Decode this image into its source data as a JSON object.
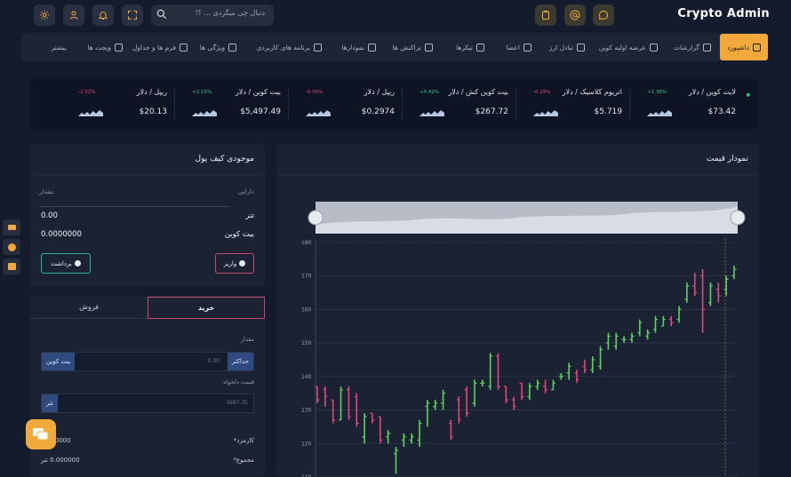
{
  "app": {
    "title": "Crypto Admin"
  },
  "search": {
    "placeholder": "دنبال چی میگردی ... ؟!"
  },
  "nav": {
    "items": [
      {
        "label": "داشبورد",
        "icon": "monitor-icon"
      },
      {
        "label": "گزارشات",
        "icon": "chart-icon"
      },
      {
        "label": "عرضه اولیه کوین",
        "icon": "clock-icon"
      },
      {
        "label": "تبادل ارز",
        "icon": "exchange-icon"
      },
      {
        "label": "اعضا",
        "icon": "users-icon"
      },
      {
        "label": "تیکرها",
        "icon": "sliders-icon"
      },
      {
        "label": "تراکنش ها",
        "icon": "dollar-icon"
      },
      {
        "label": "نمودارها",
        "icon": "pie-icon"
      },
      {
        "label": "برنامه های کاربردی",
        "icon": "grid-icon"
      },
      {
        "label": "ویژگی ها",
        "icon": "apps-icon"
      },
      {
        "label": "فرم ها و جداول",
        "icon": "form-icon"
      },
      {
        "label": "ویجت ها",
        "icon": "edit-icon"
      },
      {
        "label": "بیشتر",
        "icon": ""
      }
    ]
  },
  "tickers": [
    {
      "name": "لایت کوین / دلار",
      "change": "+1.36%",
      "price": "$73.42",
      "up": true
    },
    {
      "name": "اتریوم کلاسیک / دلار",
      "change": "-0.19%",
      "price": "$5.719",
      "up": false
    },
    {
      "name": "بیت کوین کش / دلار",
      "change": "+0.42%",
      "price": "$267.72",
      "up": true
    },
    {
      "name": "ریپل / دلار",
      "change": "-0.50%",
      "price": "$0.2974",
      "up": false
    },
    {
      "name": "بیت کوین / دلار",
      "change": "+3.15%",
      "price": "$5,497.49",
      "up": true
    },
    {
      "name": "ریپل / دلار",
      "change": "-2.52%",
      "price": "$20.13",
      "up": false
    }
  ],
  "wallet": {
    "title": "موجودی کیف پول",
    "col_asset": "دارایی",
    "col_amount": "مقدار",
    "rows": [
      {
        "asset": "تتر",
        "amount": "0.00"
      },
      {
        "asset": "بیت کوین",
        "amount": "0.0000000"
      }
    ],
    "deposit_label": "واریز",
    "withdraw_label": "برداشت"
  },
  "trade": {
    "tab_buy": "خرید",
    "tab_sell": "فروش",
    "amount_label": "مقدار",
    "max_label": "حداکثر",
    "amount_placeholder": "0.00",
    "amount_unit": "بیت کوین",
    "price_label": "قیمت دلخواه",
    "price_placeholder": "3987.35",
    "price_unit": "تتر",
    "fee_label": "کارمزد*",
    "fee_value": "0.000000",
    "total_label": "مجموع*",
    "total_value": "0.000000 تتر"
  },
  "price_chart": {
    "title": "نمودار قیمت"
  },
  "chart_data": {
    "type": "candlestick",
    "title": "نمودار قیمت",
    "yticks": [
      180,
      170,
      160,
      150,
      140,
      130,
      120,
      110
    ],
    "ylim": [
      110,
      181
    ],
    "colors": {
      "up": "#5fd35f",
      "down": "#e0487a"
    },
    "candles": [
      {
        "o": 137,
        "h": 137,
        "l": 132,
        "c": 133
      },
      {
        "o": 136,
        "h": 137,
        "l": 131,
        "c": 134
      },
      {
        "o": 133,
        "h": 133,
        "l": 126,
        "c": 127
      },
      {
        "o": 127,
        "h": 137,
        "l": 127,
        "c": 136
      },
      {
        "o": 136,
        "h": 137,
        "l": 127,
        "c": 128
      },
      {
        "o": 134,
        "h": 135,
        "l": 125,
        "c": 126
      },
      {
        "o": 122,
        "h": 129,
        "l": 120,
        "c": 128
      },
      {
        "o": 129,
        "h": 129,
        "l": 126,
        "c": 127
      },
      {
        "o": 128,
        "h": 128,
        "l": 120,
        "c": 121
      },
      {
        "o": 122,
        "h": 124,
        "l": 120,
        "c": 123
      },
      {
        "o": 117,
        "h": 119,
        "l": 111,
        "c": 118
      },
      {
        "o": 121,
        "h": 123,
        "l": 119,
        "c": 122
      },
      {
        "o": 121,
        "h": 123,
        "l": 120,
        "c": 122
      },
      {
        "o": 121,
        "h": 127,
        "l": 119,
        "c": 126
      },
      {
        "o": 131,
        "h": 133,
        "l": 125,
        "c": 132
      },
      {
        "o": 131,
        "h": 133,
        "l": 130,
        "c": 132
      },
      {
        "o": 132,
        "h": 136,
        "l": 130,
        "c": 135
      },
      {
        "o": 126,
        "h": 127,
        "l": 121,
        "c": 122
      },
      {
        "o": 133,
        "h": 134,
        "l": 126,
        "c": 127
      },
      {
        "o": 136,
        "h": 137,
        "l": 128,
        "c": 129
      },
      {
        "o": 132,
        "h": 139,
        "l": 131,
        "c": 138
      },
      {
        "o": 138,
        "h": 139,
        "l": 137,
        "c": 138
      },
      {
        "o": 137,
        "h": 147,
        "l": 136,
        "c": 146
      },
      {
        "o": 146,
        "h": 147,
        "l": 136,
        "c": 137
      },
      {
        "o": 137,
        "h": 137,
        "l": 132,
        "c": 133
      },
      {
        "o": 133,
        "h": 134,
        "l": 130,
        "c": 131
      },
      {
        "o": 138,
        "h": 138,
        "l": 133,
        "c": 134
      },
      {
        "o": 134,
        "h": 138,
        "l": 133,
        "c": 137
      },
      {
        "o": 137,
        "h": 139,
        "l": 136,
        "c": 138
      },
      {
        "o": 137,
        "h": 139,
        "l": 135,
        "c": 136
      },
      {
        "o": 136,
        "h": 139,
        "l": 136,
        "c": 138
      },
      {
        "o": 140,
        "h": 141,
        "l": 139,
        "c": 140
      },
      {
        "o": 141,
        "h": 144,
        "l": 139,
        "c": 143
      },
      {
        "o": 141,
        "h": 142,
        "l": 138,
        "c": 139
      },
      {
        "o": 143,
        "h": 145,
        "l": 141,
        "c": 142
      },
      {
        "o": 142,
        "h": 146,
        "l": 141,
        "c": 145
      },
      {
        "o": 143,
        "h": 149,
        "l": 142,
        "c": 148
      },
      {
        "o": 150,
        "h": 153,
        "l": 148,
        "c": 152
      },
      {
        "o": 149,
        "h": 153,
        "l": 148,
        "c": 152
      },
      {
        "o": 151,
        "h": 152,
        "l": 150,
        "c": 151
      },
      {
        "o": 151,
        "h": 153,
        "l": 150,
        "c": 152
      },
      {
        "o": 153,
        "h": 157,
        "l": 152,
        "c": 156
      },
      {
        "o": 152,
        "h": 154,
        "l": 151,
        "c": 153
      },
      {
        "o": 154,
        "h": 158,
        "l": 153,
        "c": 157
      },
      {
        "o": 155,
        "h": 158,
        "l": 155,
        "c": 157
      },
      {
        "o": 157,
        "h": 158,
        "l": 155,
        "c": 156
      },
      {
        "o": 157,
        "h": 161,
        "l": 156,
        "c": 160
      },
      {
        "o": 163,
        "h": 168,
        "l": 162,
        "c": 167
      },
      {
        "o": 167,
        "h": 171,
        "l": 164,
        "c": 165
      },
      {
        "o": 170,
        "h": 172,
        "l": 153,
        "c": 160
      },
      {
        "o": 162,
        "h": 168,
        "l": 161,
        "c": 167
      },
      {
        "o": 166,
        "h": 168,
        "l": 162,
        "c": 164
      },
      {
        "o": 166,
        "h": 170,
        "l": 164,
        "c": 169
      },
      {
        "o": 170,
        "h": 173,
        "l": 169,
        "c": 172
      }
    ]
  }
}
